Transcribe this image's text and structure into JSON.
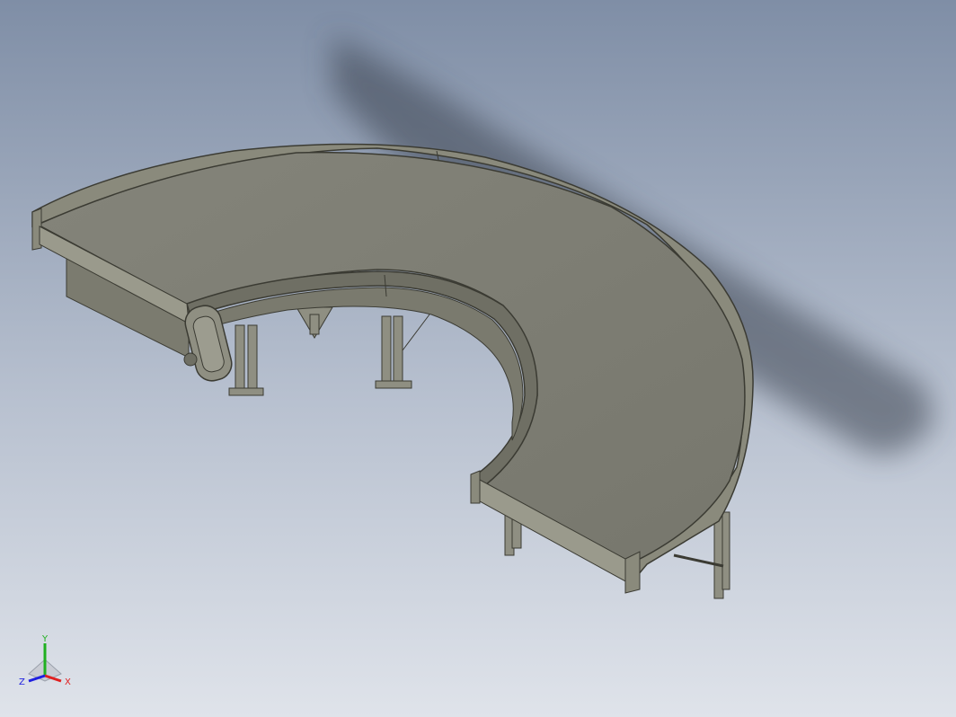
{
  "viewport": {
    "background_top": "#7f8ea6",
    "background_bottom": "#d9dee6",
    "model_colors": {
      "belt": "#7e7e74",
      "frame": "#8a8a7c",
      "frame_dark": "#5f5f54",
      "edge": "#3b3b33",
      "shadow": "#3a4250"
    }
  },
  "model": {
    "name": "curved-belt-conveyor",
    "curve_angle": "180-degree",
    "support_legs": 4
  },
  "triad": {
    "x_label": "X",
    "y_label": "Y",
    "z_label": "Z",
    "x_color": "#e02020",
    "y_color": "#20b020",
    "z_color": "#2020e0"
  }
}
